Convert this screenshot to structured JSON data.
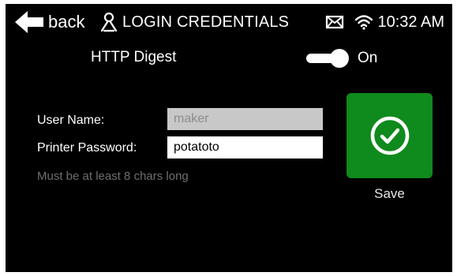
{
  "header": {
    "back_label": "back",
    "back_icon": "arrow-left-icon",
    "title_icon": "person-icon",
    "title": "LOGIN CREDENTIALS",
    "status": {
      "mail_icon": "mail-icon",
      "wifi_icon": "wifi-icon",
      "time": "10:32 AM"
    }
  },
  "digest": {
    "label": "HTTP Digest",
    "toggle_on": true,
    "state_label": "On"
  },
  "form": {
    "username": {
      "label": "User Name:",
      "value": "maker"
    },
    "password": {
      "label": "Printer Password:",
      "value": "potatoto"
    },
    "hint": "Must be at least 8 chars long"
  },
  "save": {
    "icon": "check-circle-icon",
    "label": "Save",
    "color": "#0f8a1c"
  }
}
